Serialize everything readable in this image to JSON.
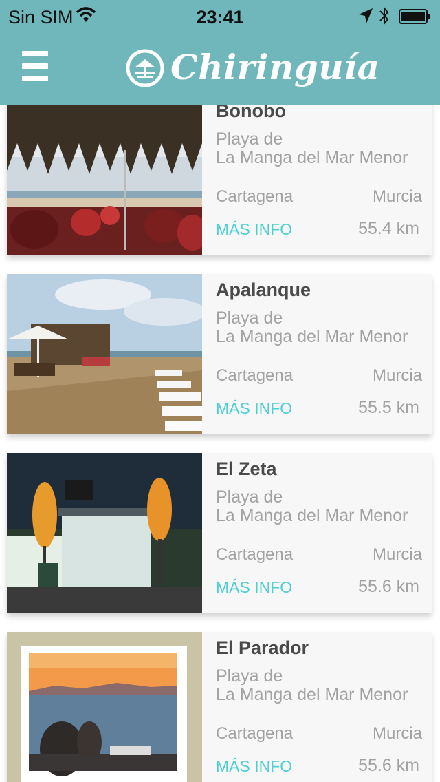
{
  "status_bar": {
    "carrier": "Sin SIM",
    "time": "23:41"
  },
  "header": {
    "title": "Chiringuía"
  },
  "colors": {
    "header_bg": "#6fb7bb",
    "accent": "#4ccfd3",
    "card_bg": "#f7f7f7"
  },
  "items": [
    {
      "name": "Bonobo",
      "address_line1": "Playa de",
      "address_line2": "La Manga del Mar Menor",
      "city": "Cartagena",
      "region": "Murcia",
      "more_label": "MÁS INFO",
      "distance": "55.4 km"
    },
    {
      "name": "Apalanque",
      "address_line1": "Playa de",
      "address_line2": "La Manga del Mar Menor",
      "city": "Cartagena",
      "region": "Murcia",
      "more_label": "MÁS INFO",
      "distance": "55.5 km"
    },
    {
      "name": "El Zeta",
      "address_line1": "Playa de",
      "address_line2": "La Manga del Mar Menor",
      "city": "Cartagena",
      "region": "Murcia",
      "more_label": "MÁS INFO",
      "distance": "55.6 km"
    },
    {
      "name": "El Parador",
      "address_line1": "Playa de",
      "address_line2": "La Manga del Mar Menor",
      "city": "Cartagena",
      "region": "Murcia",
      "more_label": "MÁS INFO",
      "distance": "55.6 km"
    }
  ]
}
